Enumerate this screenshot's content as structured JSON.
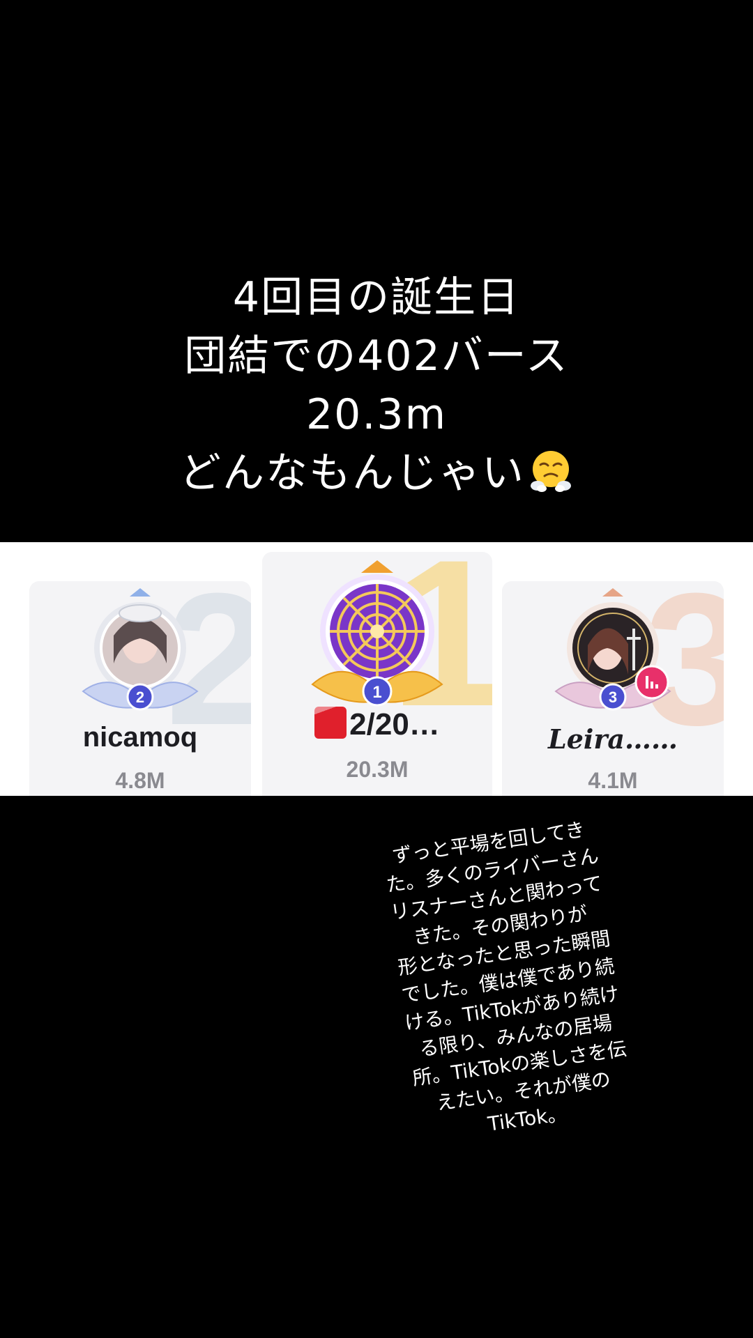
{
  "headline": {
    "lines": [
      "4回目の誕生日",
      "団結での402バース",
      "20.3m",
      "どんなもんじゃい"
    ],
    "emoji": "face-with-steam-from-nose"
  },
  "leaderboard": {
    "entries": [
      {
        "rank": "2",
        "name": "nicamoq",
        "score": "4.8M",
        "accent": "#dfe4ea"
      },
      {
        "rank": "1",
        "name": "2/20…",
        "score": "20.3M",
        "accent": "#f6dfa4"
      },
      {
        "rank": "3",
        "name": "Leira……",
        "score": "4.1M",
        "accent": "#f2d9cd"
      }
    ]
  },
  "story": {
    "lines": [
      "ずっと平場を回してき",
      "た。多くのライバーさん",
      "リスナーさんと関わって",
      "きた。その関わりが",
      "形となったと思った瞬間",
      "でした。僕は僕であり続",
      "ける。TikTokがあり続け",
      "る限り、みんなの居場",
      "所。TikTokの楽しさを伝",
      "えたい。それが僕の",
      "TikTok。"
    ]
  },
  "colors": {
    "background": "#000000",
    "panel": "#ffffff",
    "card": "#f4f4f6",
    "name_text": "#1d1d22",
    "score_text": "#8a8a90",
    "rank_badge": "#4a4fd0",
    "live_badge": "#e8306a"
  }
}
